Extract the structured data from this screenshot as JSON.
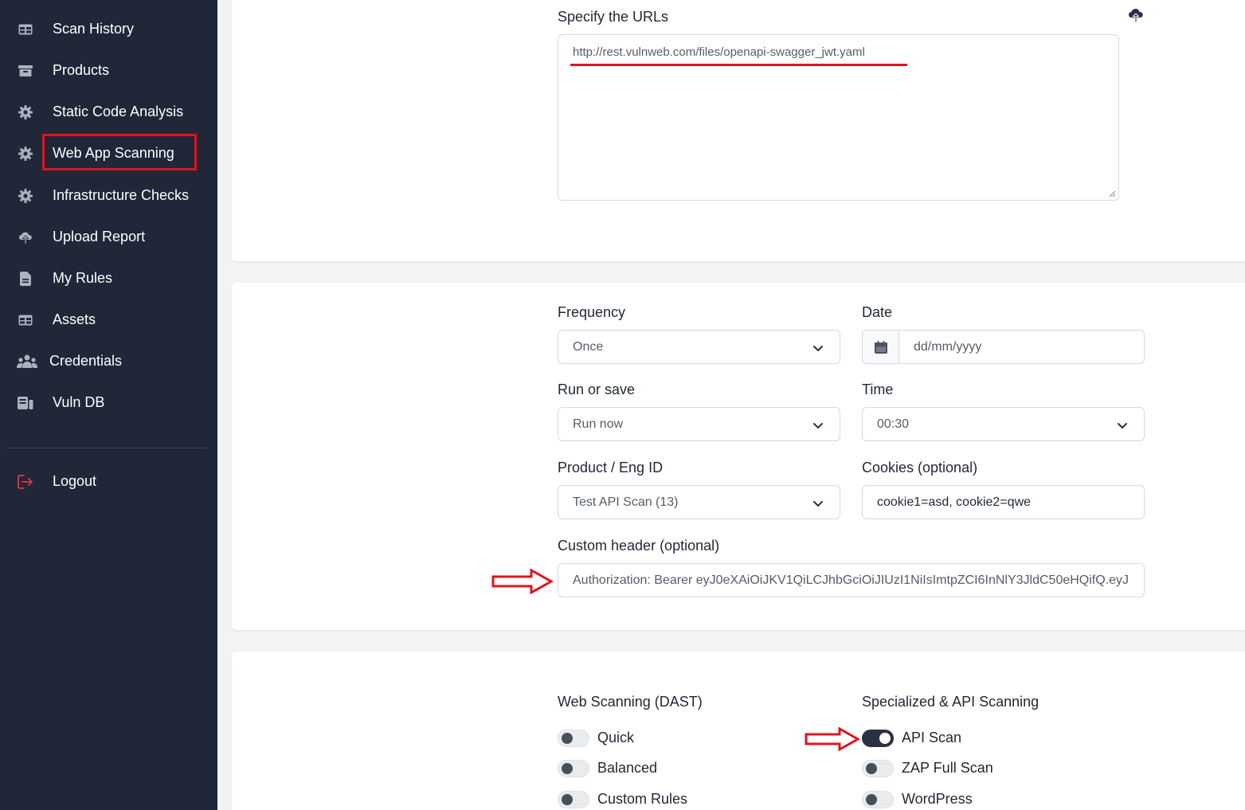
{
  "sidebar": {
    "items": [
      {
        "label": "Scan History",
        "icon": "table-icon"
      },
      {
        "label": "Products",
        "icon": "archive-icon"
      },
      {
        "label": "Static Code Analysis",
        "icon": "gear-icon"
      },
      {
        "label": "Web App Scanning",
        "icon": "gear-icon"
      },
      {
        "label": "Infrastructure Checks",
        "icon": "gear-icon"
      },
      {
        "label": "Upload Report",
        "icon": "cloud-upload-icon"
      },
      {
        "label": "My Rules",
        "icon": "file-icon"
      },
      {
        "label": "Assets",
        "icon": "table-icon"
      },
      {
        "label": "Credentials",
        "icon": "users-icon"
      },
      {
        "label": "Vuln DB",
        "icon": "database-icon"
      }
    ],
    "logout": {
      "label": "Logout",
      "icon": "logout-icon"
    }
  },
  "urls": {
    "label": "Specify the URLs",
    "value": "http://rest.vulnweb.com/files/openapi-swagger_jwt.yaml"
  },
  "schedule": {
    "frequency": {
      "label": "Frequency",
      "value": "Once"
    },
    "date": {
      "label": "Date",
      "placeholder": "dd/mm/yyyy"
    },
    "run_or_save": {
      "label": "Run or save",
      "value": "Run now"
    },
    "time": {
      "label": "Time",
      "value": "00:30"
    },
    "product": {
      "label": "Product / Eng ID",
      "value": "Test API Scan (13)"
    },
    "cookies": {
      "label": "Cookies (optional)",
      "value": "cookie1=asd, cookie2=qwe"
    },
    "custom_header": {
      "label": "Custom header (optional)",
      "value": "Authorization: Bearer eyJ0eXAiOiJKV1QiLCJhbGciOiJIUzI1NiIsImtpZCI6InNlY3JldC50eHQifQ.eyJ"
    }
  },
  "scan_types": {
    "dast_title": "Web Scanning (DAST)",
    "dast": [
      {
        "label": "Quick",
        "on": false
      },
      {
        "label": "Balanced",
        "on": false
      },
      {
        "label": "Custom Rules",
        "on": false
      }
    ],
    "api_title": "Specialized & API Scanning",
    "api": [
      {
        "label": "API Scan",
        "on": true
      },
      {
        "label": "ZAP Full Scan",
        "on": false
      },
      {
        "label": "WordPress",
        "on": false
      }
    ]
  },
  "colors": {
    "sidebar_bg": "#202738",
    "annotation_red": "#e0141e",
    "logout_icon": "#e0384a"
  }
}
